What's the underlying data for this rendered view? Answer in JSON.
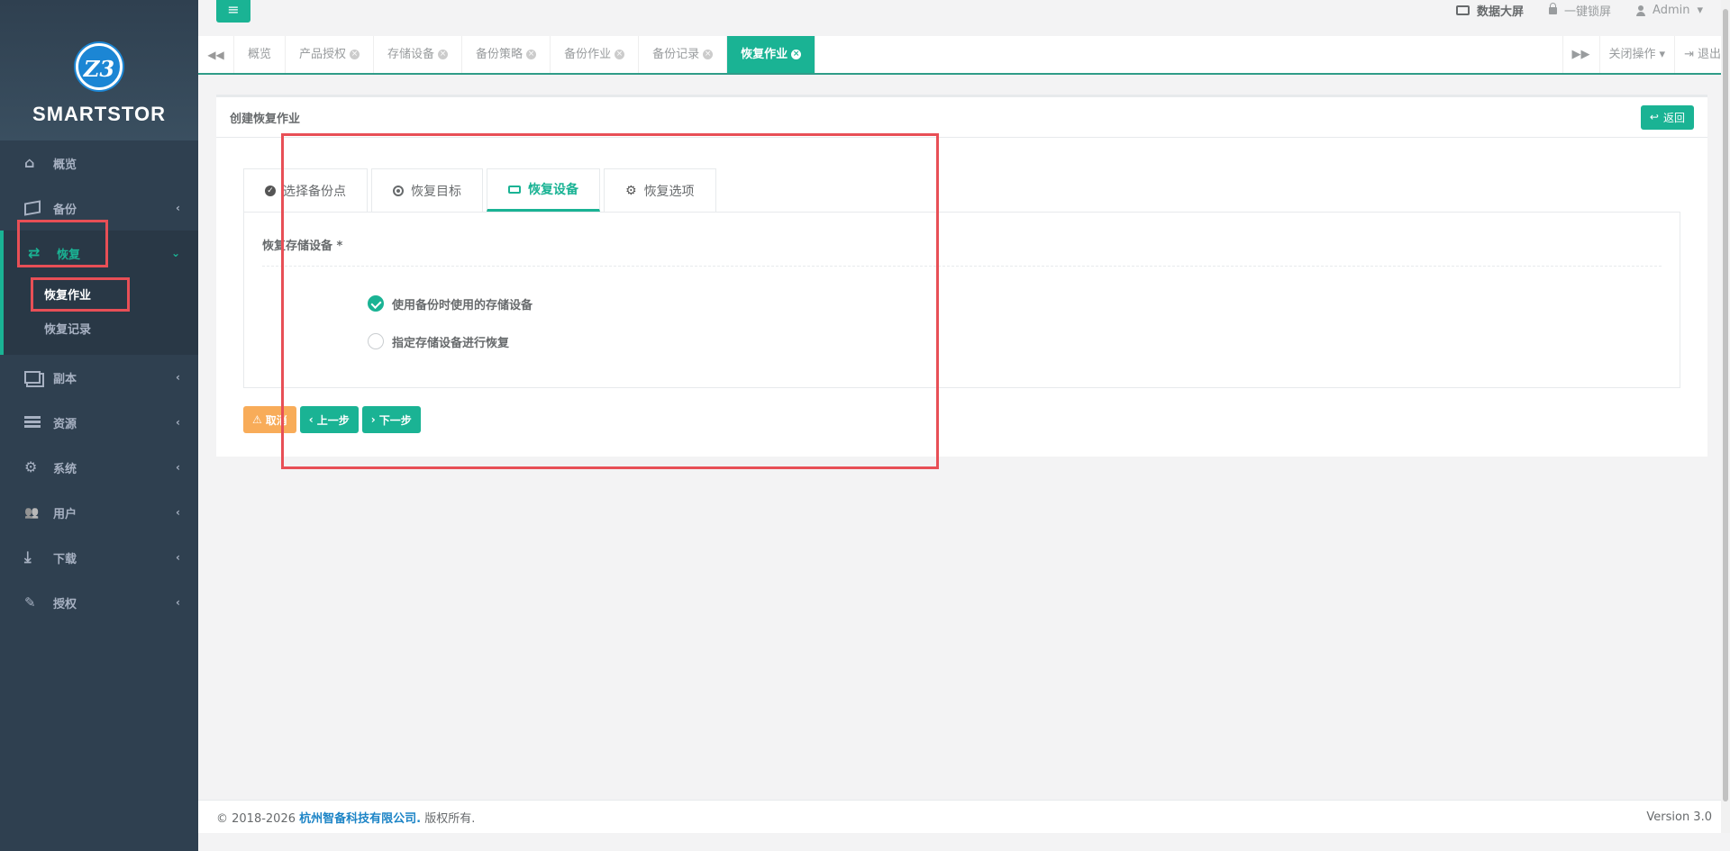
{
  "brand": {
    "logo_mark": "Z3",
    "name": "SMARTSTOR"
  },
  "sidebar": {
    "items": [
      {
        "label": "概览",
        "icon": "home-icon"
      },
      {
        "label": "备份",
        "icon": "cube-icon"
      },
      {
        "label": "恢复",
        "icon": "retweet-icon",
        "children": [
          {
            "label": "恢复作业"
          },
          {
            "label": "恢复记录"
          }
        ]
      },
      {
        "label": "副本",
        "icon": "copy-icon"
      },
      {
        "label": "资源",
        "icon": "server-icon"
      },
      {
        "label": "系统",
        "icon": "cogs-icon"
      },
      {
        "label": "用户",
        "icon": "users-icon"
      },
      {
        "label": "下载",
        "icon": "download-icon"
      },
      {
        "label": "授权",
        "icon": "edit-icon"
      }
    ]
  },
  "topbar": {
    "menu_glyph": "≡",
    "data_screen": "数据大屏",
    "lock_screen": "一键锁屏",
    "user": "Admin"
  },
  "tabs": {
    "items": [
      "概览",
      "产品授权",
      "存储设备",
      "备份策略",
      "备份作业",
      "备份记录",
      "恢复作业"
    ],
    "close_ops": "关闭操作",
    "logout": "退出"
  },
  "page": {
    "title": "创建恢复作业",
    "back_label": "返回",
    "wizard_steps": [
      "选择备份点",
      "恢复目标",
      "恢复设备",
      "恢复选项"
    ],
    "section_label": "恢复存储设备 *",
    "options": [
      "使用备份时使用的存储设备",
      "指定存储设备进行恢复"
    ],
    "selected_option": 0,
    "cancel_label": "取消",
    "prev_label": "上一步",
    "next_label": "下一步"
  },
  "footer": {
    "prefix": "© 2018-2026",
    "company": "杭州智备科技有限公司.",
    "suffix": "版权所有.",
    "version": "Version 3.0"
  },
  "colors": {
    "accent": "#1ab394",
    "sidebar_bg": "#2f4050",
    "warning": "#f8ac59",
    "highlight": "#e84f56"
  }
}
